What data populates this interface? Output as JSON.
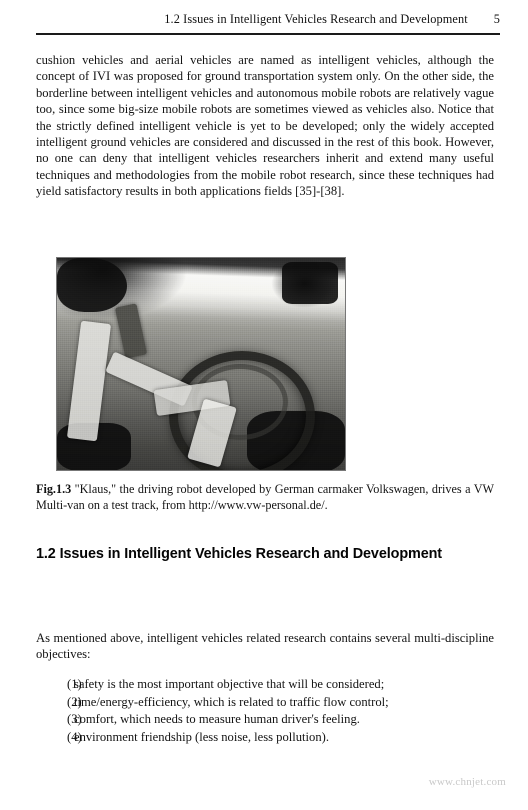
{
  "running_head": {
    "title": "1.2 Issues in Intelligent Vehicles Research and Development",
    "page_number": "5"
  },
  "paragraphs": {
    "intro": "cushion vehicles and aerial vehicles are named as intelligent vehicles, although the concept of IVI was proposed for ground transportation system only. On the other side, the borderline between intelligent vehicles and autonomous mobile robots are relatively vague too, since some big-size mobile robots are sometimes viewed as vehicles also. Notice that the strictly defined intelligent vehicle is yet to be developed; only the widely accepted intelligent ground vehicles are considered and discussed in the rest of this book. However, no one can deny that intelligent vehicles researchers inherit and extend many useful techniques and methodologies from the mobile robot research, since these techniques had yield satisfactory results in both applications fields [35]-[38].",
    "after_heading": "As mentioned above, intelligent vehicles related research contains several multi-discipline objectives:"
  },
  "figure": {
    "label": "Fig.1.3",
    "caption": "\"Klaus,\" the driving robot developed by German carmaker Volkswagen, drives a VW Multi-van on a test track, from http://www.vw-personal.de/.",
    "alt": "black-and-white photograph of a driving robot mounted at the steering wheel inside a van cabin"
  },
  "section_heading": "1.2 Issues in Intelligent Vehicles Research and Development",
  "objectives": [
    {
      "num": "(1)",
      "text": "safety is the most important objective that will be considered;"
    },
    {
      "num": "(2)",
      "text": "time/energy-efficiency, which is related to traffic flow control;"
    },
    {
      "num": "(3)",
      "text": "comfort, which needs to measure human driver's feeling."
    },
    {
      "num": "(4)",
      "text": "environment friendship (less noise, less pollution)."
    }
  ],
  "watermark": "www.chnjet.com",
  "colors": {
    "text": "#131313",
    "rule": "#1a1a1a",
    "watermark": "#c9c9c9",
    "page_background": "#ffffff"
  }
}
